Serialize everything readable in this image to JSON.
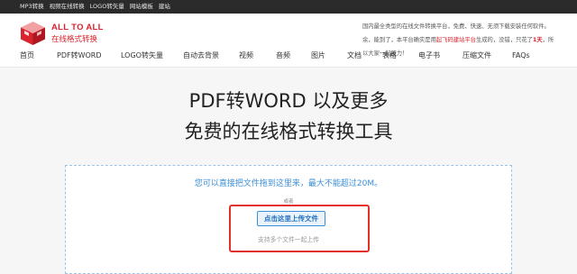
{
  "topbar": {
    "links": [
      "MP3转换",
      "视频在线转换",
      "LOGO转矢量",
      "网站模板",
      "建站"
    ]
  },
  "brand": {
    "title": "ALL TO ALL",
    "subtitle": "在线格式转换",
    "accent_color": "#d9232d"
  },
  "intro": {
    "line1": "国内最全类型的在线文件转换平台，免费、快速、无须下载安装任何软件。",
    "line2_a": "余，能到了，本平台确实是用",
    "line2_hl": "起飞码建站平台",
    "line2_b": "生成的，没错，只花了",
    "line2_strong": "1天",
    "line2_c": "，所以大家一起努力！"
  },
  "nav": {
    "items": [
      "首页",
      "PDF转WORD",
      "LOGO转矢量",
      "自动去背景",
      "视频",
      "音频",
      "图片",
      "文档",
      "表格",
      "电子书",
      "压缩文件",
      "FAQs"
    ]
  },
  "hero": {
    "title_line1": "PDF转WORD 以及更多",
    "title_line2": "免费的在线格式转换工具"
  },
  "upload": {
    "hint": "您可以直接把文件拖到这里来，最大不能超过20M。",
    "or": "或者",
    "button_label": "点击这里上传文件",
    "multi_hint": "支持多个文件一起上传",
    "link_color": "#3a8fd8",
    "highlight_color": "#e0322b"
  }
}
